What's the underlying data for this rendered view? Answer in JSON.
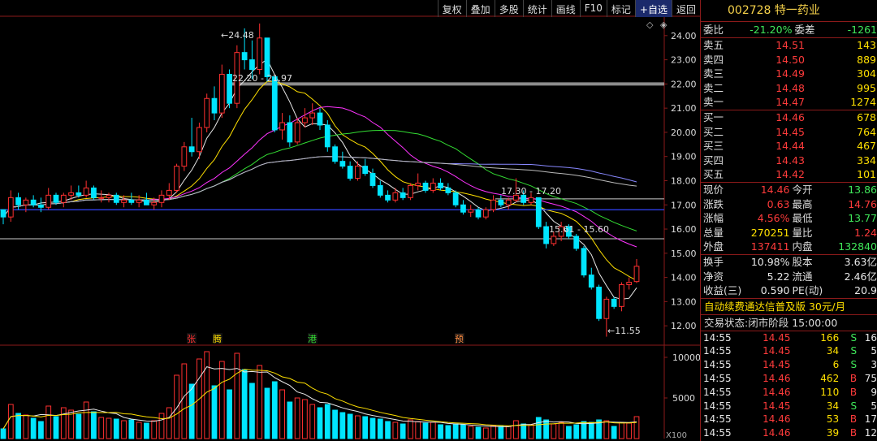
{
  "toolbar": [
    "复权",
    "叠加",
    "多股",
    "统计",
    "画线",
    "F10",
    "标记",
    "+自选",
    "返回"
  ],
  "stock": {
    "code": "002728",
    "name": "特一药业"
  },
  "ratio": {
    "weibi_label": "委比",
    "weibi": "-21.20%",
    "weicha_label": "委差",
    "weicha": "-1261"
  },
  "asks": [
    {
      "label": "卖五",
      "price": "14.51",
      "vol": "143"
    },
    {
      "label": "卖四",
      "price": "14.50",
      "vol": "889"
    },
    {
      "label": "卖三",
      "price": "14.49",
      "vol": "304"
    },
    {
      "label": "卖二",
      "price": "14.48",
      "vol": "995"
    },
    {
      "label": "卖一",
      "price": "14.47",
      "vol": "1274"
    }
  ],
  "bids": [
    {
      "label": "买一",
      "price": "14.46",
      "vol": "678"
    },
    {
      "label": "买二",
      "price": "14.45",
      "vol": "764"
    },
    {
      "label": "买三",
      "price": "14.44",
      "vol": "467"
    },
    {
      "label": "买四",
      "price": "14.43",
      "vol": "334"
    },
    {
      "label": "买五",
      "price": "14.42",
      "vol": "101"
    }
  ],
  "quote": [
    {
      "l1": "现价",
      "v1": "14.46",
      "c1": "red",
      "l2": "今开",
      "v2": "13.86",
      "c2": "grn"
    },
    {
      "l1": "涨跌",
      "v1": "0.63",
      "c1": "red",
      "l2": "最高",
      "v2": "14.76",
      "c2": "red"
    },
    {
      "l1": "涨幅",
      "v1": "4.56%",
      "c1": "red",
      "l2": "最低",
      "v2": "13.77",
      "c2": "grn"
    },
    {
      "l1": "总量",
      "v1": "270251",
      "c1": "yel",
      "l2": "量比",
      "v2": "1.24",
      "c2": "red"
    },
    {
      "l1": "外盘",
      "v1": "137411",
      "c1": "red",
      "l2": "内盘",
      "v2": "132840",
      "c2": "grn"
    }
  ],
  "fund": [
    {
      "l1": "换手",
      "v1": "10.98%",
      "l2": "股本",
      "v2": "3.63亿"
    },
    {
      "l1": "净资",
      "v1": "5.22",
      "l2": "流通",
      "v2": "2.46亿"
    },
    {
      "l1": "收益(三)",
      "v1": "0.590",
      "l2": "PE(动)",
      "v2": "20.9"
    }
  ],
  "promo": "自动续费通达信普及版 30元/月",
  "status": {
    "label": "交易状态:",
    "value": "闭市阶段 15:00:00"
  },
  "trades": [
    {
      "t": "14:55",
      "p": "14.45",
      "v": "166",
      "d": "S",
      "n": "16"
    },
    {
      "t": "14:55",
      "p": "14.45",
      "v": "34",
      "d": "S",
      "n": "5"
    },
    {
      "t": "14:55",
      "p": "14.45",
      "v": "6",
      "d": "S",
      "n": "3"
    },
    {
      "t": "14:55",
      "p": "14.46",
      "v": "462",
      "d": "B",
      "n": "75"
    },
    {
      "t": "14:55",
      "p": "14.46",
      "v": "110",
      "d": "B",
      "n": "9"
    },
    {
      "t": "14:55",
      "p": "14.45",
      "v": "34",
      "d": "S",
      "n": "5"
    },
    {
      "t": "14:55",
      "p": "14.46",
      "v": "53",
      "d": "B",
      "n": "17"
    },
    {
      "t": "14:55",
      "p": "14.46",
      "v": "39",
      "d": "B",
      "n": "12"
    }
  ],
  "chart_data": {
    "type": "candlestick",
    "y_ticks": [
      "24.00",
      "23.00",
      "22.00",
      "21.00",
      "20.00",
      "19.00",
      "18.00",
      "17.00",
      "16.00",
      "15.00",
      "14.00",
      "13.00",
      "12.00"
    ],
    "ylim": [
      11.3,
      24.8
    ],
    "vol_ticks": [
      "10000",
      "5000"
    ],
    "vol_ylim": [
      0,
      11500
    ],
    "vol_unit": "X100",
    "annotations": [
      "24.48",
      "22.20 - 21.97",
      "17.30 - 17.20",
      "15.61 - 15.60",
      "11.55"
    ],
    "markers": [
      "张",
      "腾",
      "港",
      "预"
    ],
    "h_levels": [
      22.0,
      17.25,
      15.6
    ],
    "colors": {
      "up": "#ff3030",
      "down": "#00e5ff",
      "grid": "#8b1a1a"
    },
    "candles": [
      [
        16.8,
        16.8,
        16.2,
        16.5,
        1200
      ],
      [
        16.5,
        17.6,
        16.3,
        17.3,
        4200
      ],
      [
        17.3,
        17.5,
        16.8,
        17.0,
        3100
      ],
      [
        17.0,
        17.3,
        16.7,
        17.2,
        2900
      ],
      [
        17.2,
        17.4,
        16.9,
        17.0,
        2500
      ],
      [
        17.0,
        17.3,
        16.7,
        16.9,
        2100
      ],
      [
        16.9,
        17.7,
        16.8,
        17.4,
        4000
      ],
      [
        17.4,
        17.5,
        17.0,
        17.1,
        2700
      ],
      [
        17.1,
        17.5,
        16.9,
        17.4,
        3800
      ],
      [
        17.4,
        17.8,
        17.2,
        17.5,
        3500
      ],
      [
        17.5,
        17.8,
        17.3,
        17.4,
        3000
      ],
      [
        17.4,
        18.0,
        17.3,
        17.7,
        4500
      ],
      [
        17.7,
        17.8,
        17.2,
        17.3,
        3300
      ],
      [
        17.3,
        17.6,
        17.1,
        17.3,
        2600
      ],
      [
        17.3,
        17.5,
        17.1,
        17.4,
        2500
      ],
      [
        17.4,
        17.5,
        17.0,
        17.1,
        2400
      ],
      [
        17.1,
        17.4,
        16.9,
        17.2,
        2200
      ],
      [
        17.2,
        17.5,
        17.0,
        17.1,
        2300
      ],
      [
        17.1,
        17.4,
        16.9,
        17.2,
        2000
      ],
      [
        17.2,
        17.5,
        17.0,
        17.0,
        1900
      ],
      [
        17.0,
        17.3,
        16.8,
        17.1,
        2200
      ],
      [
        17.1,
        17.6,
        16.9,
        17.4,
        3100
      ],
      [
        17.4,
        17.9,
        17.2,
        17.6,
        3800
      ],
      [
        17.6,
        18.7,
        17.5,
        18.6,
        7800
      ],
      [
        18.6,
        19.6,
        18.4,
        19.4,
        9200
      ],
      [
        19.4,
        20.6,
        19.0,
        19.2,
        6700
      ],
      [
        19.2,
        20.4,
        18.9,
        20.2,
        9800
      ],
      [
        20.2,
        21.6,
        20.0,
        21.4,
        10700
      ],
      [
        21.4,
        21.9,
        20.5,
        20.8,
        6500
      ],
      [
        20.8,
        22.8,
        20.6,
        22.4,
        9500
      ],
      [
        22.4,
        22.6,
        21.0,
        21.2,
        6000
      ],
      [
        21.2,
        23.6,
        21.0,
        23.3,
        10500
      ],
      [
        23.3,
        24.3,
        22.6,
        23.0,
        8500
      ],
      [
        23.0,
        23.8,
        22.2,
        22.6,
        6800
      ],
      [
        22.6,
        24.5,
        22.4,
        23.9,
        9000
      ],
      [
        23.9,
        23.9,
        22.1,
        22.3,
        6200
      ],
      [
        22.3,
        22.3,
        20.0,
        20.1,
        7000
      ],
      [
        20.1,
        20.8,
        19.7,
        20.4,
        6000
      ],
      [
        20.4,
        20.7,
        19.4,
        19.6,
        4500
      ],
      [
        19.6,
        20.6,
        19.5,
        20.4,
        5000
      ],
      [
        20.4,
        21.0,
        20.2,
        20.6,
        4800
      ],
      [
        20.6,
        21.2,
        20.3,
        20.8,
        4200
      ],
      [
        20.8,
        21.0,
        20.1,
        20.3,
        3800
      ],
      [
        20.3,
        20.5,
        19.2,
        19.4,
        4200
      ],
      [
        19.4,
        19.5,
        18.7,
        18.8,
        3500
      ],
      [
        18.8,
        19.2,
        18.5,
        18.6,
        3200
      ],
      [
        18.6,
        18.8,
        18.0,
        18.1,
        3000
      ],
      [
        18.1,
        18.8,
        18.0,
        18.6,
        2800
      ],
      [
        18.6,
        18.9,
        18.2,
        18.3,
        2700
      ],
      [
        18.3,
        18.5,
        17.7,
        17.8,
        2500
      ],
      [
        17.8,
        18.0,
        17.3,
        17.4,
        2400
      ],
      [
        17.4,
        17.6,
        17.1,
        17.2,
        2100
      ],
      [
        17.2,
        17.7,
        17.1,
        17.5,
        2000
      ],
      [
        17.5,
        17.7,
        17.2,
        17.3,
        1800
      ],
      [
        17.3,
        17.9,
        17.2,
        17.8,
        2300
      ],
      [
        17.8,
        18.3,
        17.6,
        17.9,
        2100
      ],
      [
        17.9,
        18.0,
        17.5,
        17.6,
        1900
      ],
      [
        17.6,
        18.1,
        17.5,
        17.9,
        2000
      ],
      [
        17.9,
        18.1,
        17.6,
        17.7,
        1700
      ],
      [
        17.7,
        17.9,
        17.4,
        17.5,
        1600
      ],
      [
        17.5,
        17.6,
        16.9,
        17.0,
        1800
      ],
      [
        17.0,
        17.2,
        16.6,
        16.7,
        1700
      ],
      [
        16.7,
        17.0,
        16.5,
        16.8,
        1500
      ],
      [
        16.8,
        16.9,
        16.4,
        16.5,
        1400
      ],
      [
        16.5,
        16.9,
        16.4,
        16.8,
        1300
      ],
      [
        16.8,
        17.4,
        16.7,
        17.2,
        1600
      ],
      [
        17.2,
        17.4,
        16.9,
        17.0,
        1500
      ],
      [
        17.0,
        17.3,
        16.8,
        17.2,
        1500
      ],
      [
        17.2,
        18.1,
        17.1,
        17.4,
        2200
      ],
      [
        17.4,
        17.6,
        17.0,
        17.1,
        1800
      ],
      [
        17.1,
        17.5,
        17.0,
        17.3,
        1700
      ],
      [
        17.3,
        17.3,
        16.0,
        16.1,
        2600
      ],
      [
        16.1,
        16.3,
        15.2,
        15.4,
        2300
      ],
      [
        15.4,
        15.9,
        15.3,
        15.7,
        1800
      ],
      [
        15.7,
        16.3,
        15.5,
        16.1,
        2000
      ],
      [
        16.1,
        16.2,
        15.6,
        15.7,
        1500
      ],
      [
        15.7,
        15.8,
        15.1,
        15.2,
        1700
      ],
      [
        15.2,
        15.3,
        14.0,
        14.1,
        2100
      ],
      [
        14.1,
        14.4,
        13.5,
        13.6,
        2000
      ],
      [
        13.6,
        13.7,
        12.2,
        12.3,
        2300
      ],
      [
        12.3,
        13.2,
        11.55,
        13.1,
        2200
      ],
      [
        13.1,
        13.2,
        12.7,
        12.8,
        1500
      ],
      [
        12.8,
        13.8,
        12.6,
        13.7,
        2000
      ],
      [
        13.7,
        14.0,
        13.5,
        13.8,
        1900
      ],
      [
        13.83,
        14.76,
        13.77,
        14.46,
        2700
      ]
    ]
  }
}
